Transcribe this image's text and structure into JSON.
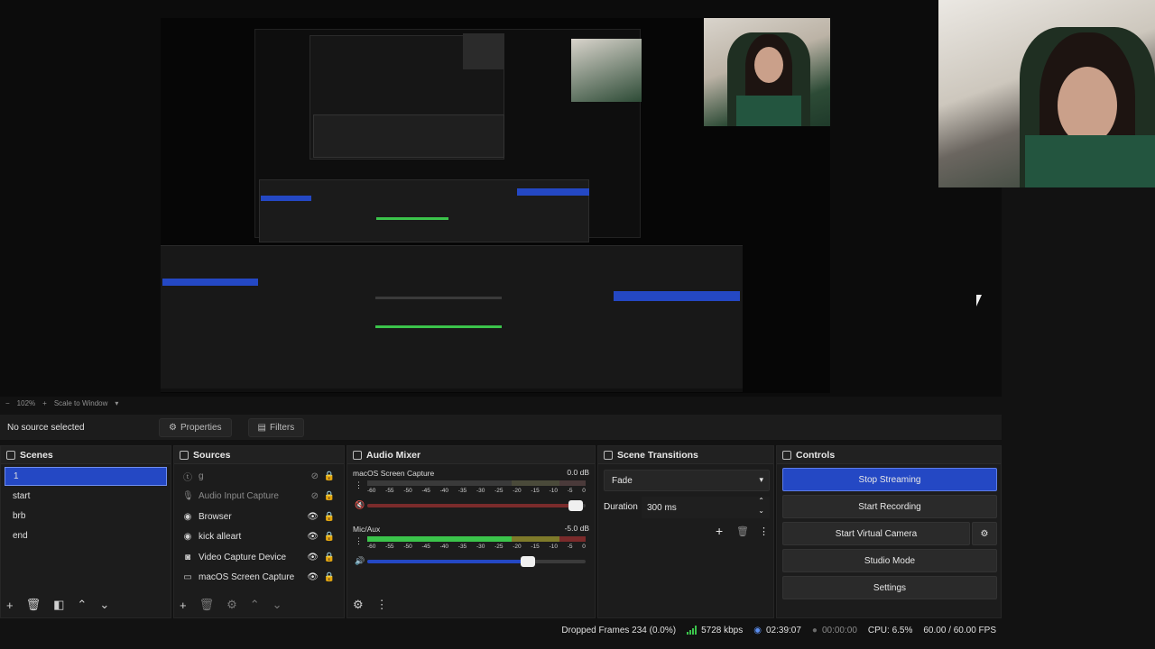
{
  "zoom": {
    "minus": "−",
    "value": "102%",
    "plus": "+",
    "mode": "Scale to Window",
    "chevron": "▾"
  },
  "source_bar": {
    "no_source": "No source selected",
    "properties": "Properties",
    "filters": "Filters"
  },
  "scenes": {
    "title": "Scenes",
    "items": [
      {
        "label": "1",
        "selected": true
      },
      {
        "label": "start",
        "selected": false
      },
      {
        "label": "brb",
        "selected": false
      },
      {
        "label": "end",
        "selected": false
      }
    ]
  },
  "sources": {
    "title": "Sources",
    "items": [
      {
        "label": "g",
        "icon": "text-icon",
        "visible": false
      },
      {
        "label": "Audio Input Capture",
        "icon": "microphone-icon",
        "visible": false
      },
      {
        "label": "Browser",
        "icon": "globe-icon",
        "visible": true
      },
      {
        "label": "kick alleart",
        "icon": "globe-icon",
        "visible": true
      },
      {
        "label": "Video Capture Device",
        "icon": "camera-icon",
        "visible": true
      },
      {
        "label": "macOS Screen Capture",
        "icon": "monitor-icon",
        "visible": true
      }
    ]
  },
  "audio_mixer": {
    "title": "Audio Mixer",
    "ticks": [
      "-60",
      "-55",
      "-50",
      "-45",
      "-40",
      "-35",
      "-30",
      "-25",
      "-20",
      "-15",
      "-10",
      "-5",
      "0"
    ],
    "channels": [
      {
        "name": "macOS Screen Capture",
        "db": "0.0 dB",
        "fader_level": 0.97,
        "muted": true
      },
      {
        "name": "Mic/Aux",
        "db": "-5.0 dB",
        "fader_level": 0.75,
        "muted": false
      }
    ]
  },
  "scene_transitions": {
    "title": "Scene Transitions",
    "transition": "Fade",
    "duration_label": "Duration",
    "duration_value": "300 ms"
  },
  "controls": {
    "title": "Controls",
    "stop_streaming": "Stop Streaming",
    "start_recording": "Start Recording",
    "start_virtual_camera": "Start Virtual Camera",
    "studio_mode": "Studio Mode",
    "settings": "Settings"
  },
  "status": {
    "dropped_frames": "Dropped Frames 234 (0.0%)",
    "bitrate": "5728 kbps",
    "stream_time": "02:39:07",
    "record_time": "00:00:00",
    "cpu": "CPU: 6.5%",
    "fps": "60.00 / 60.00 FPS"
  },
  "colors": {
    "accent": "#2448c4",
    "meter_green": "#3bc44b",
    "meter_yellow": "#c9c23a",
    "meter_red": "#c43b3b"
  }
}
